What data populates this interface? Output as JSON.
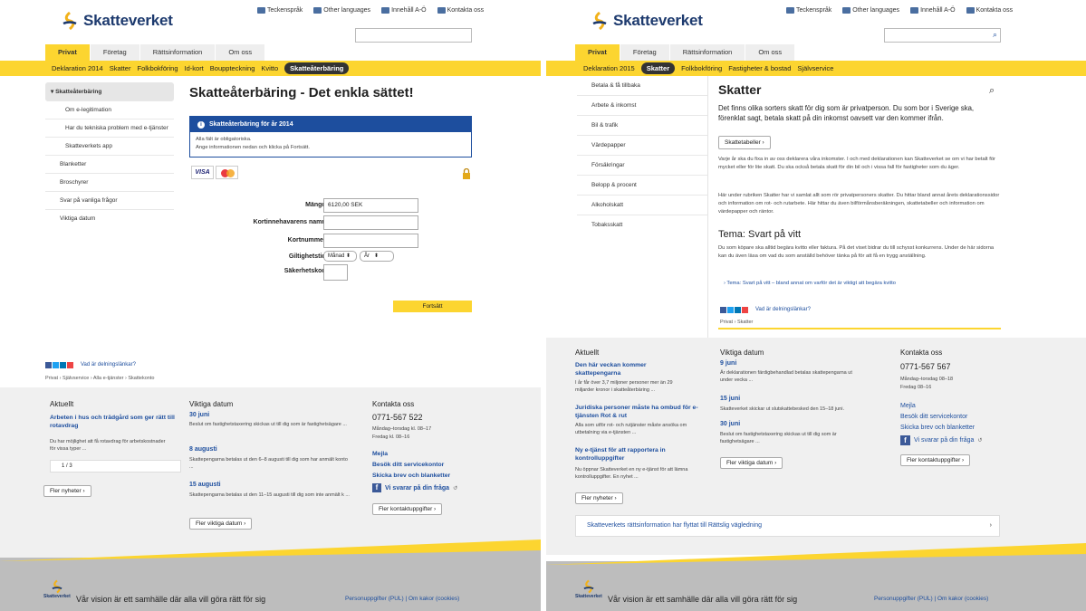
{
  "brand": "Skatteverket",
  "left": {
    "toplinks": [
      "Teckenspråk",
      "Other languages",
      "Innehåll A-Ö",
      "Kontakta oss"
    ],
    "tabs": [
      "Privat",
      "Företag",
      "Rättsinformation",
      "Om oss"
    ],
    "subnav": [
      "Deklaration 2014",
      "Skatter",
      "Folkbokföring",
      "Id-kort",
      "Bouppteckning",
      "Kvitto",
      "Skatteåterbäring"
    ],
    "sidebar": {
      "active": "▾ Skatteåterbäring",
      "children": [
        "Om e-legitimation",
        "Har du tekniska problem med e-tjänster",
        "Skatteverkets app"
      ],
      "items": [
        "Blanketter",
        "Broschyrer",
        "Svar på vanliga frågor",
        "Viktiga datum"
      ]
    },
    "title": "Skatteåterbäring - Det enkla sättet!",
    "info_title": "Skatteåterbäring för år 2014",
    "info_lines": [
      "Alla fält är obligatoriska.",
      "Ange informationen nedan och klicka på Fortsätt."
    ],
    "card_logos": [
      "VISA",
      "MC"
    ],
    "form": {
      "amount_label": "Mängd:",
      "amount_value": "6120,00 SEK",
      "name_label": "Kortinnehavarens namn:",
      "number_label": "Kortnummer:",
      "expiry_label": "Giltighetstid:",
      "month": "Månad",
      "year": "År",
      "cvc_label": "Säkerhetskod:",
      "submit": "Fortsätt"
    },
    "share_text": "Vad är delningslänkar?",
    "crumb": "Privat › Självservice › Alla e-tjänster › Skattekonto",
    "footer": {
      "col1_title": "Aktuellt",
      "col1_link": "Arbeten i hus och trädgård som ger rätt till rotavdrag",
      "col1_text": "Du har möjlighet att få rotavdrag för arbetskostnader för vissa typer ...",
      "pager": "1 / 3",
      "col1_btn": "Fler nyheter  ›",
      "col2_title": "Viktiga datum",
      "d1": "30 juni",
      "d1t": "Beslut om fastighetstaxering skickas ut till dig som är fastighetsägare ...",
      "d2": "8 augusti",
      "d2t": "Skattepengarna betalas ut den 6–8 augusti till dig som har anmält konto ...",
      "d3": "15 augusti",
      "d3t": "Skattepengarna betalas ut den 11–15 augusti till dig som inte anmält k ...",
      "col2_btn": "Fler viktiga datum  ›",
      "col3_title": "Kontakta oss",
      "phone": "0771-567 522",
      "hours1": "Måndag–torsdag kl. 08–17",
      "hours2": "Fredag kl. 08–16",
      "l1": "Mejla",
      "l2": "Besök ditt servicekontor",
      "l3": "Skicka brev och blanketter",
      "fb": "Vi svarar på din fråga",
      "col3_btn": "Fler kontaktuppgifter  ›"
    },
    "vision": "Vår vision är ett samhälle där alla vill göra rätt för sig",
    "legal": "Personuppgifter (PUL) | Om kakor (cookies)"
  },
  "right": {
    "toplinks": [
      "Teckenspråk",
      "Other languages",
      "Innehåll A-Ö",
      "Kontakta oss"
    ],
    "tabs": [
      "Privat",
      "Företag",
      "Rättsinformation",
      "Om oss"
    ],
    "subnav": [
      "Deklaration 2015",
      "Skatter",
      "Folkbokföring",
      "Fastigheter & bostad",
      "Självservice"
    ],
    "sidebar": [
      "Betala & få tillbaka",
      "Arbete & inkomst",
      "Bil & trafik",
      "Värdepapper",
      "Försäkringar",
      "Belopp & procent",
      "Alkoholskatt",
      "Tobaksskatt"
    ],
    "title": "Skatter",
    "lead": "Det finns olika sorters skatt för dig som är privatperson. Du som bor i Sverige ska, förenklat sagt, betala skatt på din inkomst oavsett var den kommer ifrån.",
    "tab_btn": "Skattetabeller  ›",
    "p1": "Varje år ska du fixa in av oss deklarera våra inkomster. I och med deklarationen kan Skatteverket se om vi har betalt för mycket eller för lite skatt. Du ska också betala skatt för din bil och i vissa fall för fastigheter som du äger.",
    "p2": "Här under rubriken Skatter har vi samlat allt som rör privatpersoners skatter. Du hittar bland annat årets deklarationssidor och information om rot- och rutarbete. Här hittar du även bilförmånsberäkningen, skattetabeller och information om värdepapper och räntor.",
    "theme_title": "Tema: Svart på vitt",
    "theme_text": "Du som köpare ska alltid begära kvitto eller faktura. På det viset bidrar du till schysst konkurrens. Under de här sidorna kan du även läsa om vad du som anställd behöver tänka på för att få en trygg anställning.",
    "theme_link": "› Tema: Svart på vitt – bland annat om varför det är viktigt att begära kvitto",
    "share_text": "Vad är delningslänkar?",
    "crumb": "Privat › Skatter",
    "footer": {
      "col1_title": "Aktuellt",
      "n1": "Den här veckan kommer skattepengarna",
      "n1t": "I år får över 3,7 miljoner personer mer än 29 miljarder kronor i skatteåterbäring ...",
      "n2": "Juridiska personer måste ha ombud för e-tjänsten Rot & rut",
      "n2t": "Alla som utför rot- och rutjänster måste ansöka om utbetalning via e-tjänsten ...",
      "n3": "Ny e-tjänst för att rapportera in kontrolluppgifter",
      "n3t": "Nu öppnar Skatteverket en ny e-tjänst för att lämna kontrolluppgifter. En nyhet ...",
      "col1_btn": "Fler nyheter  ›",
      "col2_title": "Viktiga datum",
      "d1": "9 juni",
      "d1t": "Är deklarationen färdigbehandlad betalas skattepengarna ut under vecka ...",
      "d2": "15 juni",
      "d2t": "Skatteverket skickar ut slutskattebesked den 15–18 juni.",
      "d3": "30 juni",
      "d3t": "Beslut om fastighetstaxering skickas ut till dig som är fastighetsägare ...",
      "col2_btn": "Fler viktiga datum  ›",
      "col3_title": "Kontakta oss",
      "phone": "0771-567 567",
      "hours1": "Måndag–torsdag 08–18",
      "hours2": "Fredag 08–16",
      "l1": "Mejla",
      "l2": "Besök ditt servicekontor",
      "l3": "Skicka brev och blanketter",
      "fb": "Vi svarar på din fråga",
      "col3_btn": "Fler kontaktuppgifter  ›"
    },
    "banner": "Skatteverkets rättsinformation har flyttat till Rättslig vägledning",
    "vision": "Vår vision är ett samhälle där alla vill göra rätt för sig",
    "legal": "Personuppgifter (PUL) | Om kakor (cookies)"
  },
  "colors": {
    "yellow": "#fcd530",
    "blue": "#1d4e9e",
    "navy": "#1d3a6e"
  }
}
